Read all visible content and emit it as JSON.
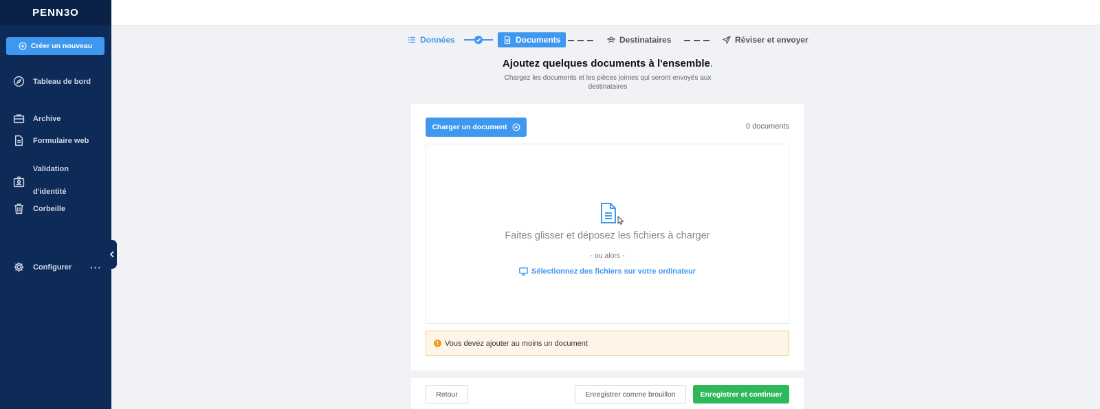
{
  "app": {
    "logo": "PENN3O"
  },
  "sidebar": {
    "create_label": "Créer un nouveau",
    "items": [
      {
        "label": "Tableau de bord",
        "icon": "compass-icon"
      },
      {
        "label": "Archive",
        "icon": "briefcase-icon"
      },
      {
        "label": "Formulaire web",
        "icon": "document-icon"
      },
      {
        "label_line1": "Validation",
        "label_line2": "d'identité",
        "icon": "id-card-icon"
      },
      {
        "label": "Corbeille",
        "icon": "trash-icon"
      },
      {
        "label": "Configurer",
        "icon": "gear-icon"
      }
    ],
    "more": "···"
  },
  "stepper": {
    "steps": [
      {
        "label": "Données",
        "state": "done",
        "icon": "list-icon"
      },
      {
        "label": "Documents",
        "state": "active",
        "icon": "document-icon"
      },
      {
        "label": "Destinataires",
        "state": "pending",
        "icon": "users-icon"
      },
      {
        "label": "Réviser et envoyer",
        "state": "pending",
        "icon": "send-icon"
      }
    ]
  },
  "main": {
    "title": "Ajoutez quelques documents à l'ensemble",
    "title_dot": ".",
    "subtitle": "Chargez les documents et les pièces jointes qui seront envoyés aux destinataires",
    "upload_label": "Charger un document",
    "doc_count": "0 documents",
    "drop_text": "Faites glisser et déposez les fichiers à charger",
    "or_text": "- ou alors -",
    "select_link": "Sélectionnez des fichiers sur votre ordinateur",
    "warning": "Vous devez ajouter au moins un document"
  },
  "footer": {
    "back_label": "Retour",
    "draft_label": "Enregistrer comme brouillon",
    "save_label": "Enregistrer et continuer"
  },
  "colors": {
    "sidebar": "#0e2a56",
    "accent": "#3f98ef",
    "success": "#2fb75b",
    "warning_bg": "#fef4e8"
  }
}
